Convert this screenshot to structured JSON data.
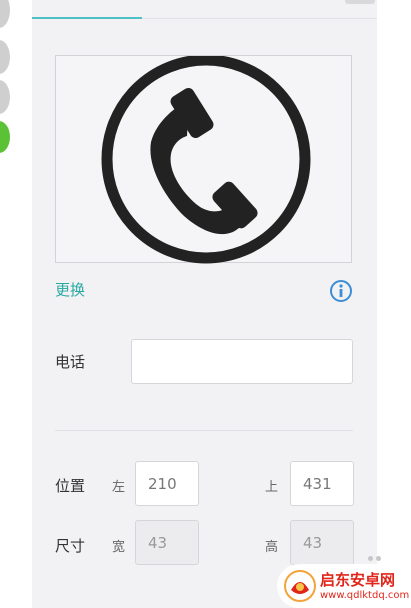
{
  "icon_card": {
    "icon": "phone-handset-icon",
    "replace_label": "更换",
    "info_icon": "info-icon"
  },
  "form": {
    "phone": {
      "label": "电话",
      "value": "",
      "placeholder": ""
    },
    "position": {
      "label": "位置",
      "left_label": "左",
      "left_value": "210",
      "top_label": "上",
      "top_value": "431"
    },
    "size": {
      "label": "尺寸",
      "width_label": "宽",
      "width_value": "43",
      "height_label": "高",
      "height_value": "43"
    }
  },
  "watermark": {
    "title": "启东安卓网",
    "url": "www.qdlktdq.com"
  },
  "colors": {
    "accent": "#2aa9a3",
    "tab_underline": "#4dc1c5",
    "active_dot": "#5bc236",
    "watermark": "#e0261b"
  }
}
